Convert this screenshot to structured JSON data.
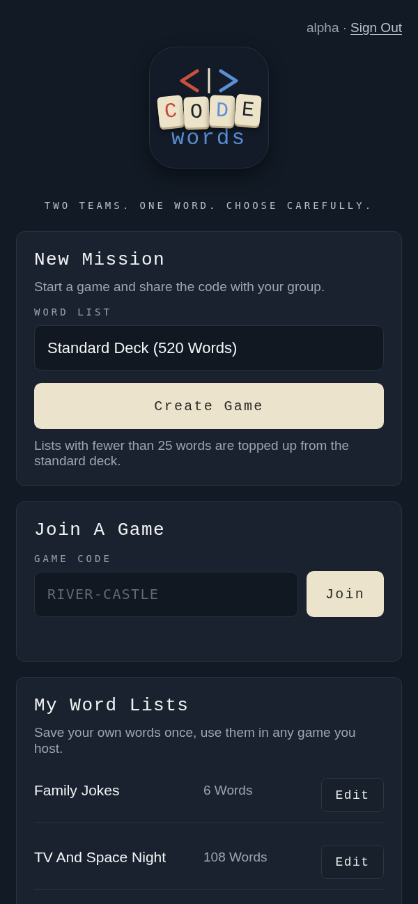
{
  "header": {
    "user_label": "alpha ·",
    "sign_out_link": "Sign Out"
  },
  "logo": {
    "tiles": [
      {
        "letter": "C",
        "color": "#c4483a"
      },
      {
        "letter": "O",
        "color": "#1d232c"
      },
      {
        "letter": "D",
        "color": "#5a8fd8"
      },
      {
        "letter": "E",
        "color": "#1d232c"
      }
    ],
    "wordmark": "words"
  },
  "tagline": "TWO TEAMS. ONE WORD. CHOOSE CAREFULLY.",
  "new_mission": {
    "title": "New Mission",
    "description": "Start a game and share the code with your group.",
    "word_list_label": "WORD LIST",
    "word_list_value": "Standard Deck (520 Words)",
    "create_button": "Create Game",
    "note": "Lists with fewer than 25 words are topped up from the standard deck."
  },
  "join_game": {
    "title": "Join A Game",
    "code_label": "GAME CODE",
    "code_placeholder": "RIVER-CASTLE",
    "join_button": "Join"
  },
  "word_lists": {
    "title": "My Word Lists",
    "description": "Save your own words once, use them in any game you host.",
    "items": [
      {
        "name": "Family Jokes",
        "count": "6 Words",
        "edit_button": "Edit"
      },
      {
        "name": "TV And Space Night",
        "count": "108 Words",
        "edit_button": "Edit"
      }
    ]
  }
}
